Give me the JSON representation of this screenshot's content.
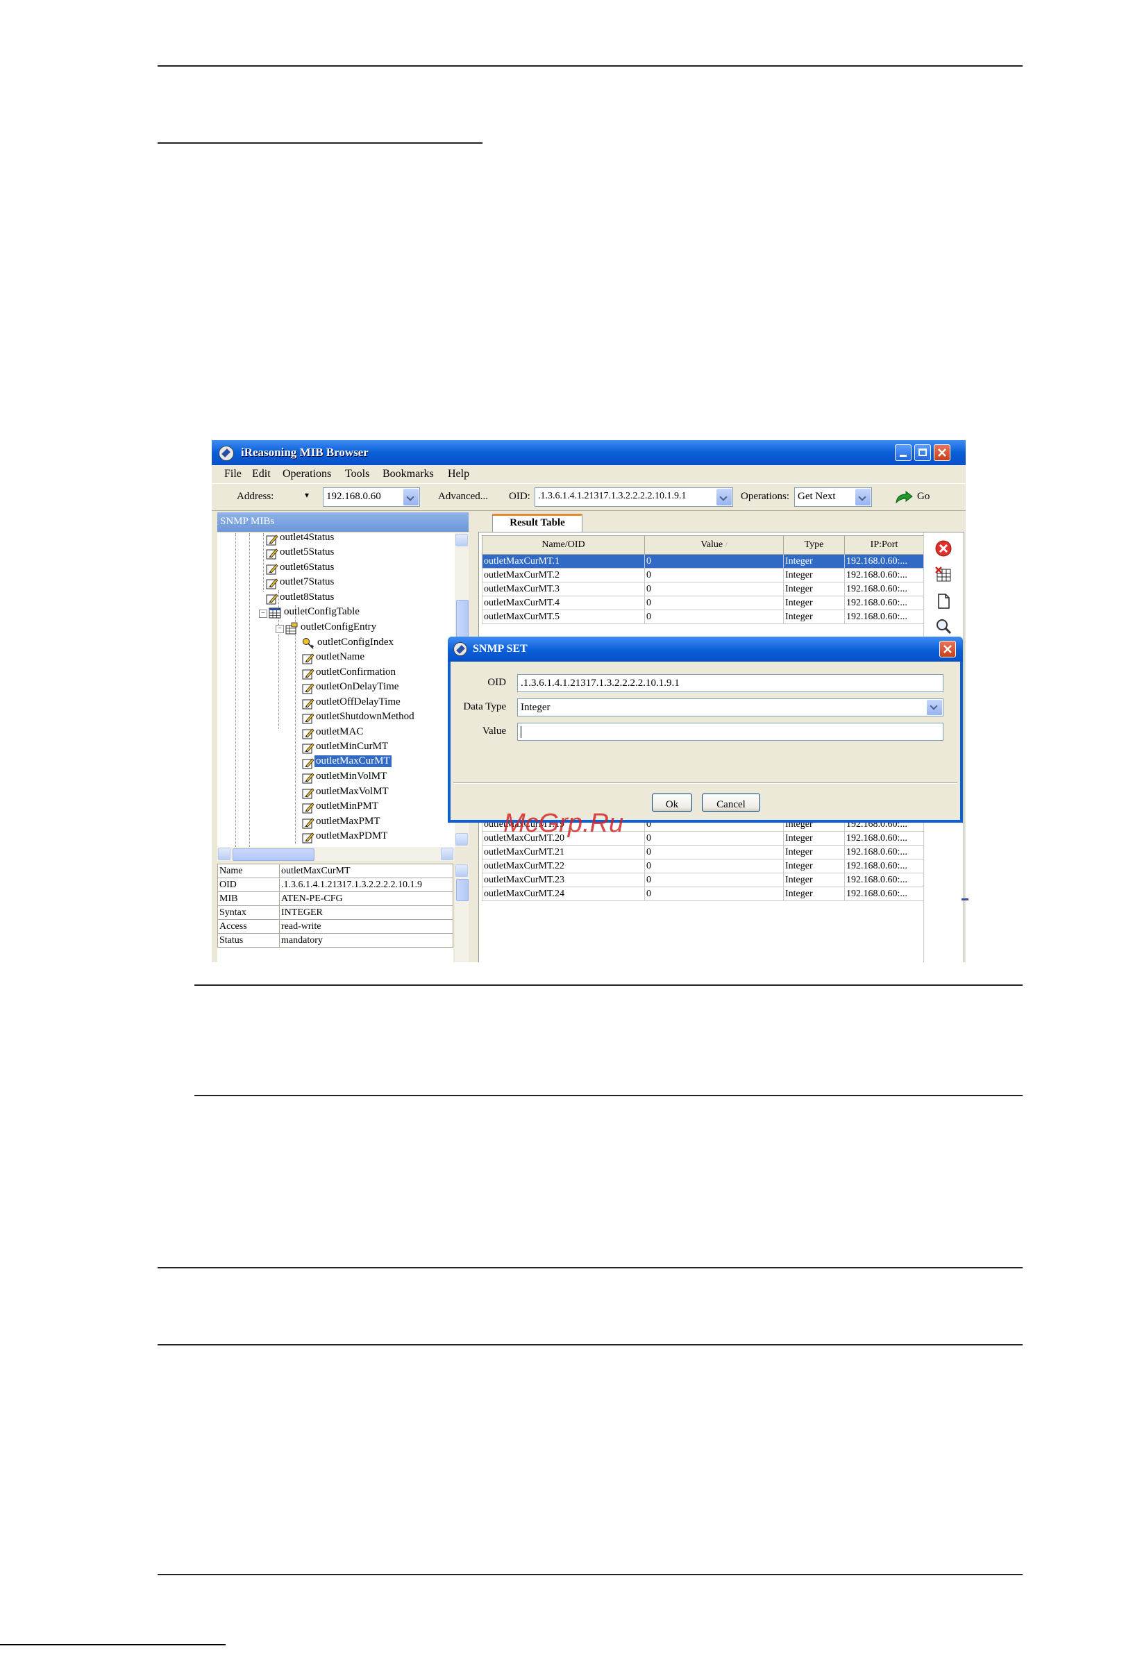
{
  "window": {
    "title": "iReasoning MIB Browser",
    "menu": [
      "File",
      "Edit",
      "Operations",
      "Tools",
      "Bookmarks",
      "Help"
    ],
    "toolbar": {
      "address_label": "Address:",
      "address_value": "192.168.0.60",
      "advanced_label": "Advanced...",
      "oid_label": "OID:",
      "oid_value": ".1.3.6.1.4.1.21317.1.3.2.2.2.2.10.1.9.1",
      "operations_label": "Operations:",
      "operations_value": "Get Next",
      "go_label": "Go"
    },
    "left_panel": {
      "header": "SNMP MIBs",
      "tree": [
        "outlet4Status",
        "outlet5Status",
        "outlet6Status",
        "outlet7Status",
        "outlet8Status",
        "outletConfigTable",
        "outletConfigEntry",
        "outletConfigIndex",
        "outletName",
        "outletConfirmation",
        "outletOnDelayTime",
        "outletOffDelayTime",
        "outletShutdownMethod",
        "outletMAC",
        "outletMinCurMT",
        "outletMaxCurMT",
        "outletMinVolMT",
        "outletMaxVolMT",
        "outletMinPMT",
        "outletMaxPMT",
        "outletMaxPDMT"
      ],
      "selected": "outletMaxCurMT",
      "properties": [
        {
          "key": "Name",
          "value": "outletMaxCurMT"
        },
        {
          "key": "OID",
          "value": ".1.3.6.1.4.1.21317.1.3.2.2.2.2.10.1.9"
        },
        {
          "key": "MIB",
          "value": "ATEN-PE-CFG"
        },
        {
          "key": "Syntax",
          "value": "INTEGER"
        },
        {
          "key": "Access",
          "value": "read-write"
        },
        {
          "key": "Status",
          "value": "mandatory"
        }
      ]
    },
    "result_table": {
      "tab_label": "Result Table",
      "columns": [
        "Name/OID",
        "Value",
        "Type",
        "IP:Port"
      ],
      "sort_mark": "/",
      "rows_top": [
        {
          "name": "outletMaxCurMT.1",
          "value": "0",
          "type": "Integer",
          "ip": "192.168.0.60:..."
        },
        {
          "name": "outletMaxCurMT.2",
          "value": "0",
          "type": "Integer",
          "ip": "192.168.0.60:..."
        },
        {
          "name": "outletMaxCurMT.3",
          "value": "0",
          "type": "Integer",
          "ip": "192.168.0.60:..."
        },
        {
          "name": "outletMaxCurMT.4",
          "value": "0",
          "type": "Integer",
          "ip": "192.168.0.60:..."
        },
        {
          "name": "outletMaxCurMT.5",
          "value": "0",
          "type": "Integer",
          "ip": "192.168.0.60:..."
        }
      ],
      "rows_bottom": [
        {
          "name": "outletMaxCurMT.19",
          "value": "0",
          "type": "Integer",
          "ip": "192.168.0.60:..."
        },
        {
          "name": "outletMaxCurMT.20",
          "value": "0",
          "type": "Integer",
          "ip": "192.168.0.60:..."
        },
        {
          "name": "outletMaxCurMT.21",
          "value": "0",
          "type": "Integer",
          "ip": "192.168.0.60:..."
        },
        {
          "name": "outletMaxCurMT.22",
          "value": "0",
          "type": "Integer",
          "ip": "192.168.0.60:..."
        },
        {
          "name": "outletMaxCurMT.23",
          "value": "0",
          "type": "Integer",
          "ip": "192.168.0.60:..."
        },
        {
          "name": "outletMaxCurMT.24",
          "value": "0",
          "type": "Integer",
          "ip": "192.168.0.60:..."
        }
      ],
      "selected_row": "outletMaxCurMT.1"
    }
  },
  "dialog": {
    "title": "SNMP SET",
    "oid_label": "OID",
    "oid_value": ".1.3.6.1.4.1.21317.1.3.2.2.2.2.10.1.9.1",
    "data_type_label": "Data Type",
    "data_type_value": "Integer",
    "value_label": "Value",
    "value_value": "",
    "ok_label": "Ok",
    "cancel_label": "Cancel"
  },
  "watermark": "McGrp.Ru",
  "icons": {
    "window": [
      "app-icon",
      "minimize-icon",
      "maximize-icon",
      "close-icon",
      "go-arrow-icon"
    ],
    "side_toolbar": [
      "stop-icon",
      "clear-table-icon",
      "document-icon",
      "search-icon"
    ],
    "tree": [
      "leaf-node-icon",
      "table-icon",
      "entry-icon",
      "key-icon"
    ]
  },
  "colors": {
    "titlebar": "#0a5fd8",
    "selection": "#316ac5",
    "watermark": "#d21e1e"
  }
}
